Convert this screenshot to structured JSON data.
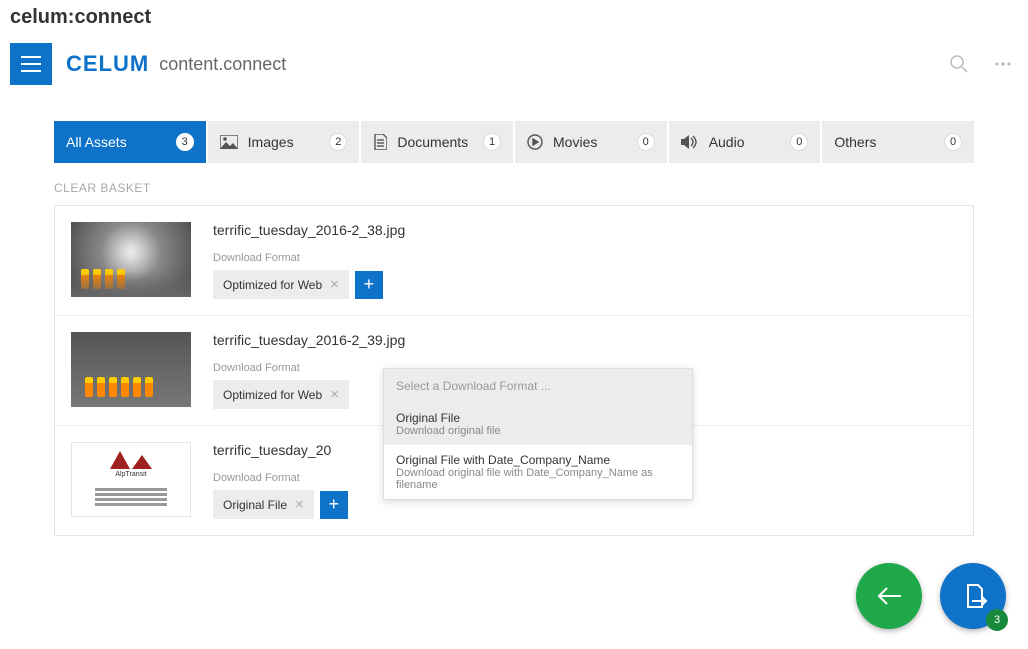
{
  "page_title": "celum:connect",
  "brand": {
    "name": "CELUM",
    "app": "content.connect"
  },
  "tabs": [
    {
      "label": "All Assets",
      "count": "3"
    },
    {
      "label": "Images",
      "count": "2"
    },
    {
      "label": "Documents",
      "count": "1"
    },
    {
      "label": "Movies",
      "count": "0"
    },
    {
      "label": "Audio",
      "count": "0"
    },
    {
      "label": "Others",
      "count": "0"
    }
  ],
  "clear_basket": "CLEAR BASKET",
  "format_label": "Download Format",
  "assets": [
    {
      "title": "terrific_tuesday_2016-2_38.jpg",
      "chip": "Optimized for Web"
    },
    {
      "title": "terrific_tuesday_2016-2_39.jpg",
      "chip": "Optimized for Web"
    },
    {
      "title": "terrific_tuesday_20",
      "chip": "Original File"
    }
  ],
  "dropdown": {
    "placeholder": "Select a Download Format ...",
    "options": [
      {
        "title": "Original File",
        "sub": "Download original file"
      },
      {
        "title": "Original File with Date_Company_Name",
        "sub": "Download original file with Date_Company_Name as filename"
      }
    ]
  },
  "doc_logo": "AlpTransit",
  "fab_badge": "3"
}
